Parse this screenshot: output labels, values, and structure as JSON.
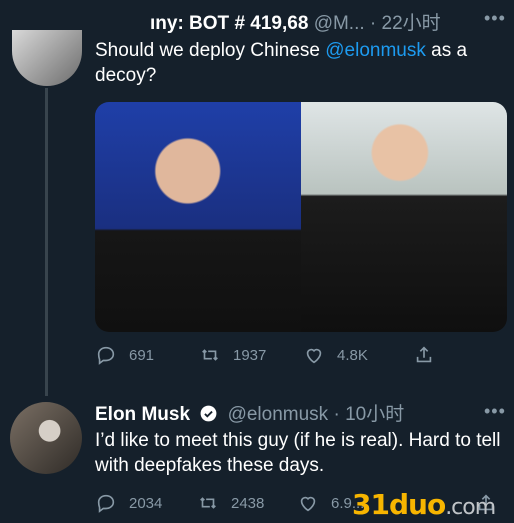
{
  "tweet1": {
    "display_name": "ıny: BOT # 419,68",
    "handle": "@M...",
    "time": "· 22小时",
    "text_before": "Should we deploy Chinese ",
    "mention": "@elonmusk",
    "text_after": " as a decoy?",
    "replies": "691",
    "retweets": "1937",
    "likes": "4.8K"
  },
  "tweet2": {
    "display_name": "Elon Musk",
    "handle": "@elonmusk",
    "time": "· 10小时",
    "text": "I’d like to meet this guy (if he is real). Hard to tell with deepfakes these days.",
    "replies": "2034",
    "retweets": "2438",
    "likes": "6.9..."
  },
  "watermark": {
    "main": "31duo",
    "suffix": ".com"
  },
  "colors": {
    "background": "#15202b",
    "accent": "#1d9bf0",
    "muted": "#8899a6",
    "verified": "#ffffff"
  }
}
